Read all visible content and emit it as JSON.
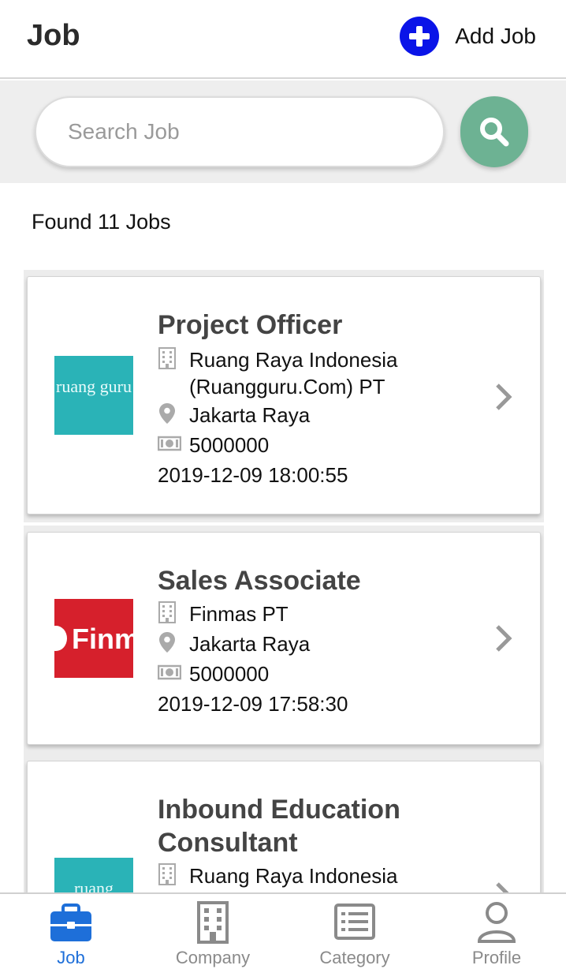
{
  "header": {
    "title": "Job",
    "add_job_label": "Add Job",
    "accent_color": "#0a14e8"
  },
  "search": {
    "placeholder": "Search Job",
    "value": "",
    "button_color": "#6db293"
  },
  "results": {
    "found_text": "Found 11 Jobs"
  },
  "jobs": [
    {
      "title": "Project Officer",
      "company": "Ruang Raya Indonesia (Ruangguru.Com) PT",
      "logo_text": "ruang guru",
      "location": "Jakarta Raya",
      "salary": "5000000",
      "date": "2019-12-09 18:00:55"
    },
    {
      "title": "Sales Associate",
      "company": "Finmas PT",
      "logo_text": "Finma",
      "location": "Jakarta Raya",
      "salary": "5000000",
      "date": "2019-12-09 17:58:30"
    },
    {
      "title": "Inbound Education Consultant",
      "company": "Ruang Raya Indonesia",
      "logo_text": "ruang"
    }
  ],
  "bottom_nav": {
    "items": [
      {
        "label": "Job",
        "icon": "briefcase-icon",
        "active": true
      },
      {
        "label": "Company",
        "icon": "building-icon",
        "active": false
      },
      {
        "label": "Category",
        "icon": "list-icon",
        "active": false
      },
      {
        "label": "Profile",
        "icon": "person-icon",
        "active": false
      }
    ],
    "active_color": "#1e6fd9"
  }
}
